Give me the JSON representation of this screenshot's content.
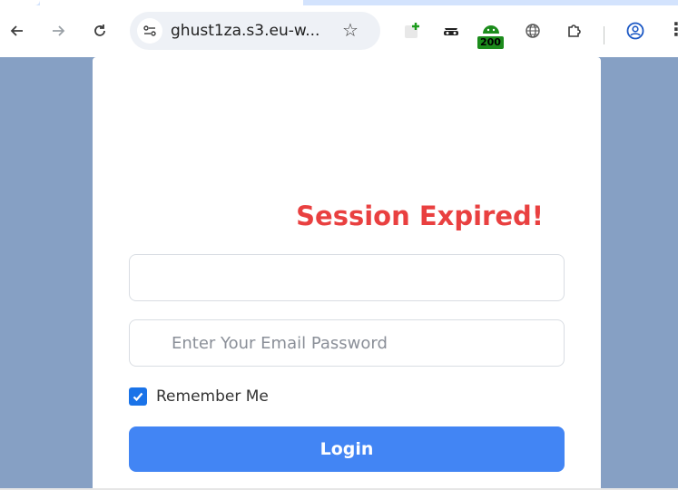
{
  "browser": {
    "url": "ghust1za.s3.eu-w...",
    "back_icon": "arrow-left-icon",
    "forward_icon": "arrow-right-icon",
    "reload_icon": "reload-icon",
    "site_info_icon": "tune-icon",
    "bookmark_icon": "star-icon",
    "extensions": [
      {
        "name": "add-extension-icon"
      },
      {
        "name": "spy-extension-icon"
      },
      {
        "name": "android-extension-icon",
        "badge": "200"
      },
      {
        "name": "globe-extension-icon"
      },
      {
        "name": "puzzle-icon"
      }
    ],
    "profile_icon": "profile-icon",
    "menu_icon": "menu-dots-icon"
  },
  "page": {
    "title": "Session Expired!",
    "email_value": "",
    "password_placeholder": "Enter Your Email Password",
    "remember_checked": true,
    "remember_label": "Remember Me",
    "login_label": "Login"
  },
  "colors": {
    "background": "#86a0c4",
    "title": "#e94040",
    "button": "#4285f4",
    "checkbox": "#1a73e8"
  }
}
